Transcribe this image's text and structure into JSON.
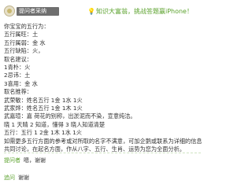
{
  "header": {
    "username": "提问者采纳",
    "banner": "知识大富翁，挑战答题赢iPhone！"
  },
  "post": {
    "lines": [
      "你宝宝的五行为：",
      "五行属旺：土",
      "五行属弱：金 水",
      "五行缺陷：火，",
      "取名建议：",
      "1青朴：火",
      "2忌讳：土",
      "3喜用：金 水",
      "取名推荐：",
      "武荣敏：姓名五行 1金 1水 1火",
      "武家烨：姓名五行 1金 1木 1火",
      "武嘉瑄：嘉 荷花的别称，出淤泥而不染，宣意纯洁。",
      "晓 1 天晴 2 知道，懂得 3 晓人知道清楚",
      "五行：五行 1 2金 1木 1水 1火",
      "如需更多五行方面的参考或对所取的名字不满意，可加企鹅或联系为详细的信息共同讨论，在起名方面，作从八字、五行、生肖、运势为您为全面分析。"
    ]
  },
  "replies": [
    {
      "name": "提问者",
      "text": "嗯，谢谢"
    },
    {
      "name": "追问",
      "text": "谢谢"
    }
  ]
}
